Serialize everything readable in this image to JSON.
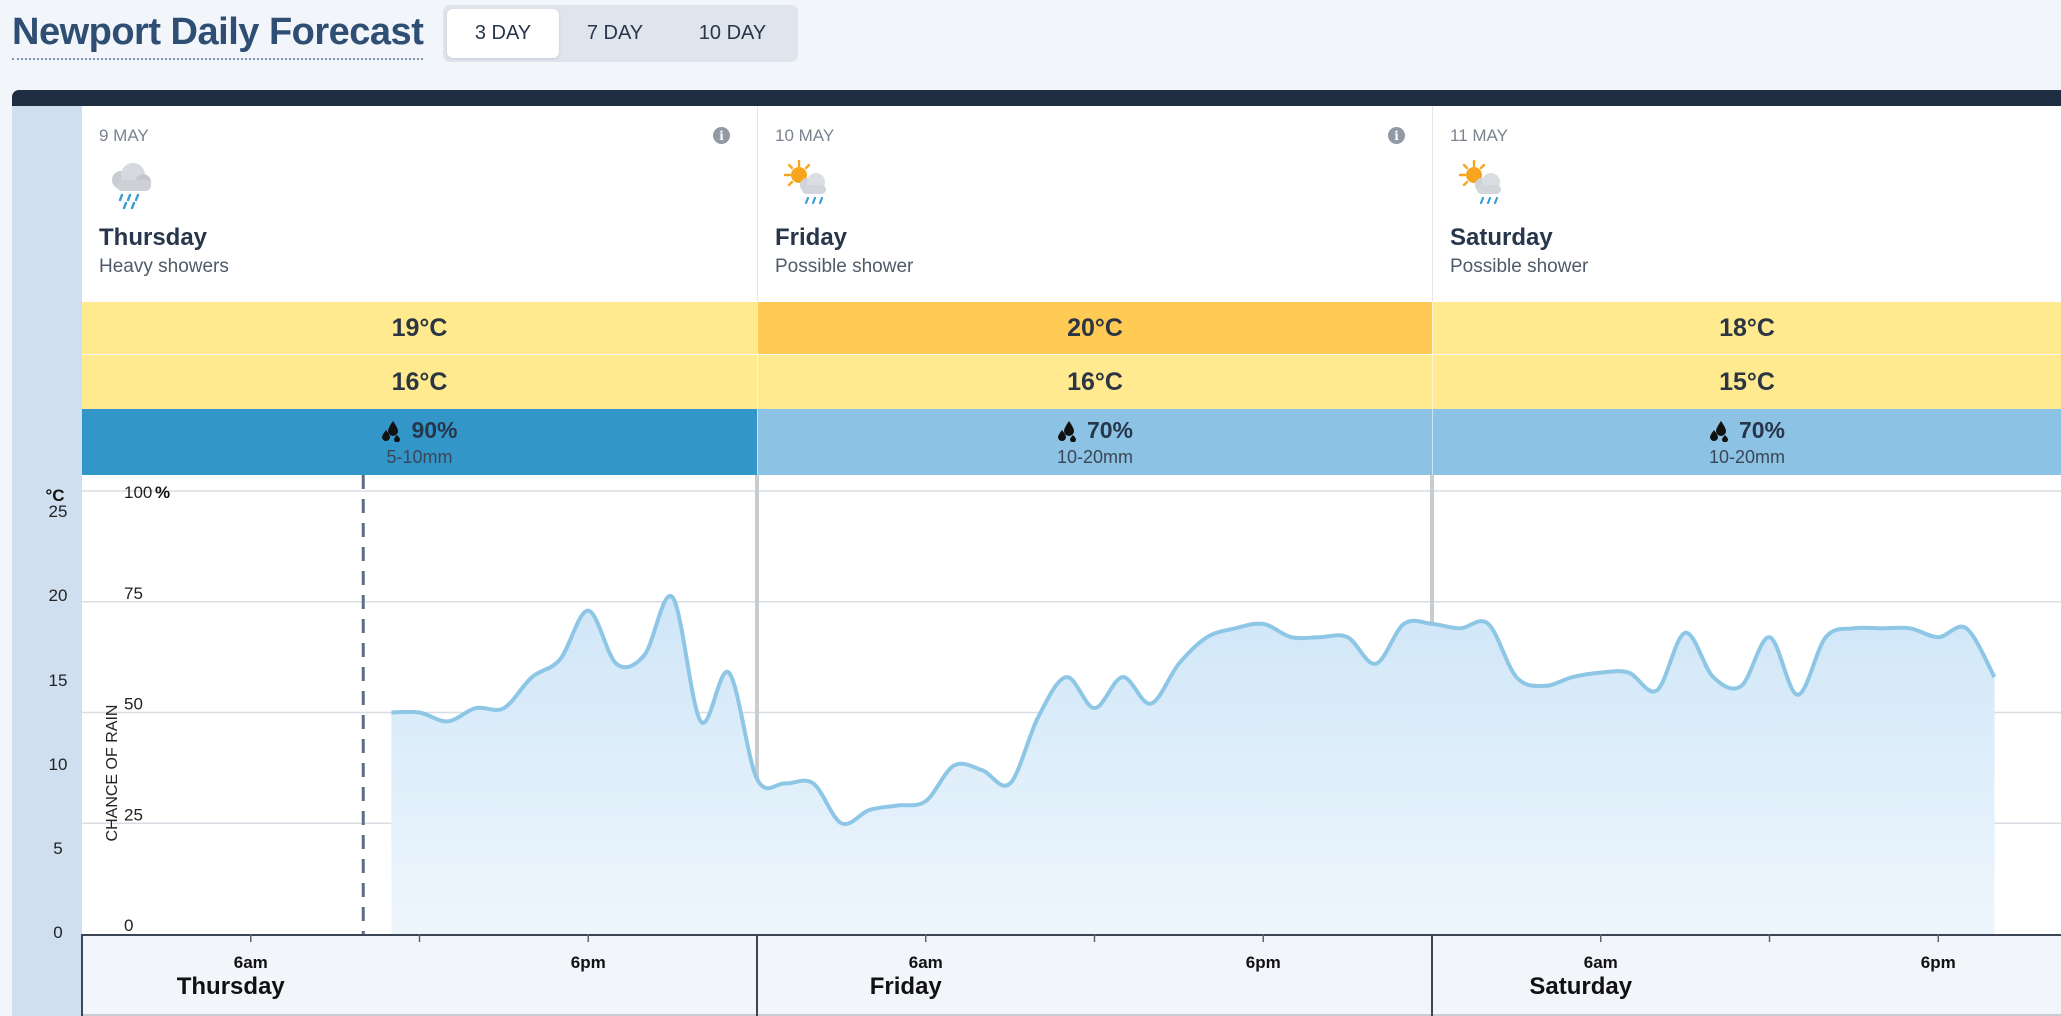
{
  "page": {
    "title": "Newport Daily Forecast"
  },
  "tabs": [
    {
      "label": "3 DAY",
      "active": true
    },
    {
      "label": "7 DAY",
      "active": false
    },
    {
      "label": "10 DAY",
      "active": false
    }
  ],
  "days": [
    {
      "date": "9 MAY",
      "day": "Thursday",
      "desc": "Heavy showers",
      "icon": "heavy-showers-icon",
      "max": "19°C",
      "min": "16°C",
      "rain_pct": "90%",
      "rain_mm": "5-10mm",
      "max_color": "#ffea8f",
      "min_color": "#ffea8f",
      "rain_color": "#3297c8",
      "info": "i"
    },
    {
      "date": "10 MAY",
      "day": "Friday",
      "desc": "Possible shower",
      "icon": "sun-shower-icon",
      "max": "20°C",
      "min": "16°C",
      "rain_pct": "70%",
      "rain_mm": "10-20mm",
      "max_color": "#ffcb55",
      "min_color": "#ffea8f",
      "rain_color": "#8cc2e3",
      "info": "i"
    },
    {
      "date": "11 MAY",
      "day": "Saturday",
      "desc": "Possible shower",
      "icon": "sun-shower-icon",
      "max": "18°C",
      "min": "15°C",
      "rain_pct": "70%",
      "rain_mm": "10-20mm",
      "max_color": "#ffea8f",
      "min_color": "#ffea8f",
      "rain_color": "#8cc2e3"
    }
  ],
  "chart_data": {
    "type": "area",
    "title": "",
    "ylabel": "CHANCE OF RAIN",
    "temp_axis_label": "°C",
    "temp_ticks": [
      "0",
      "5",
      "10",
      "15",
      "20",
      "25"
    ],
    "rain_ticks": [
      "0",
      "25",
      "50",
      "75",
      "100"
    ],
    "rain_top_unit": "%",
    "ylim": [
      0,
      100
    ],
    "x_hours_range": [
      0,
      72
    ],
    "now_hour": 10,
    "day_labels": [
      "Thursday",
      "Friday",
      "Saturday"
    ],
    "time_ticks": [
      {
        "hour": 6,
        "label": "6am"
      },
      {
        "hour": 18,
        "label": "6pm"
      },
      {
        "hour": 30,
        "label": "6am"
      },
      {
        "hour": 42,
        "label": "6pm"
      },
      {
        "hour": 54,
        "label": "6am"
      },
      {
        "hour": 66,
        "label": "6pm"
      }
    ],
    "series": [
      {
        "values": [
          [
            11,
            50
          ],
          [
            12,
            50
          ],
          [
            13,
            48
          ],
          [
            14,
            51
          ],
          [
            15,
            51
          ],
          [
            16,
            58
          ],
          [
            17,
            62
          ],
          [
            18,
            73
          ],
          [
            19,
            61
          ],
          [
            20,
            63
          ],
          [
            21,
            76
          ],
          [
            22,
            48
          ],
          [
            23,
            59
          ],
          [
            24,
            35
          ],
          [
            25,
            34
          ],
          [
            26,
            34
          ],
          [
            27,
            25
          ],
          [
            28,
            28
          ],
          [
            29,
            29
          ],
          [
            30,
            30
          ],
          [
            31,
            38
          ],
          [
            32,
            37
          ],
          [
            33,
            34
          ],
          [
            34,
            49
          ],
          [
            35,
            58
          ],
          [
            36,
            51
          ],
          [
            37,
            58
          ],
          [
            38,
            52
          ],
          [
            39,
            61
          ],
          [
            40,
            67
          ],
          [
            41,
            69
          ],
          [
            42,
            70
          ],
          [
            43,
            67
          ],
          [
            44,
            67
          ],
          [
            45,
            67
          ],
          [
            46,
            61
          ],
          [
            47,
            70
          ],
          [
            48,
            70
          ],
          [
            49,
            69
          ],
          [
            50,
            70
          ],
          [
            51,
            58
          ],
          [
            52,
            56
          ],
          [
            53,
            58
          ],
          [
            54,
            59
          ],
          [
            55,
            59
          ],
          [
            56,
            55
          ],
          [
            57,
            68
          ],
          [
            58,
            58
          ],
          [
            59,
            56
          ],
          [
            60,
            67
          ],
          [
            61,
            54
          ],
          [
            62,
            67
          ],
          [
            63,
            69
          ],
          [
            64,
            69
          ],
          [
            65,
            69
          ],
          [
            66,
            67
          ],
          [
            67,
            69
          ],
          [
            68,
            58
          ]
        ]
      }
    ]
  }
}
